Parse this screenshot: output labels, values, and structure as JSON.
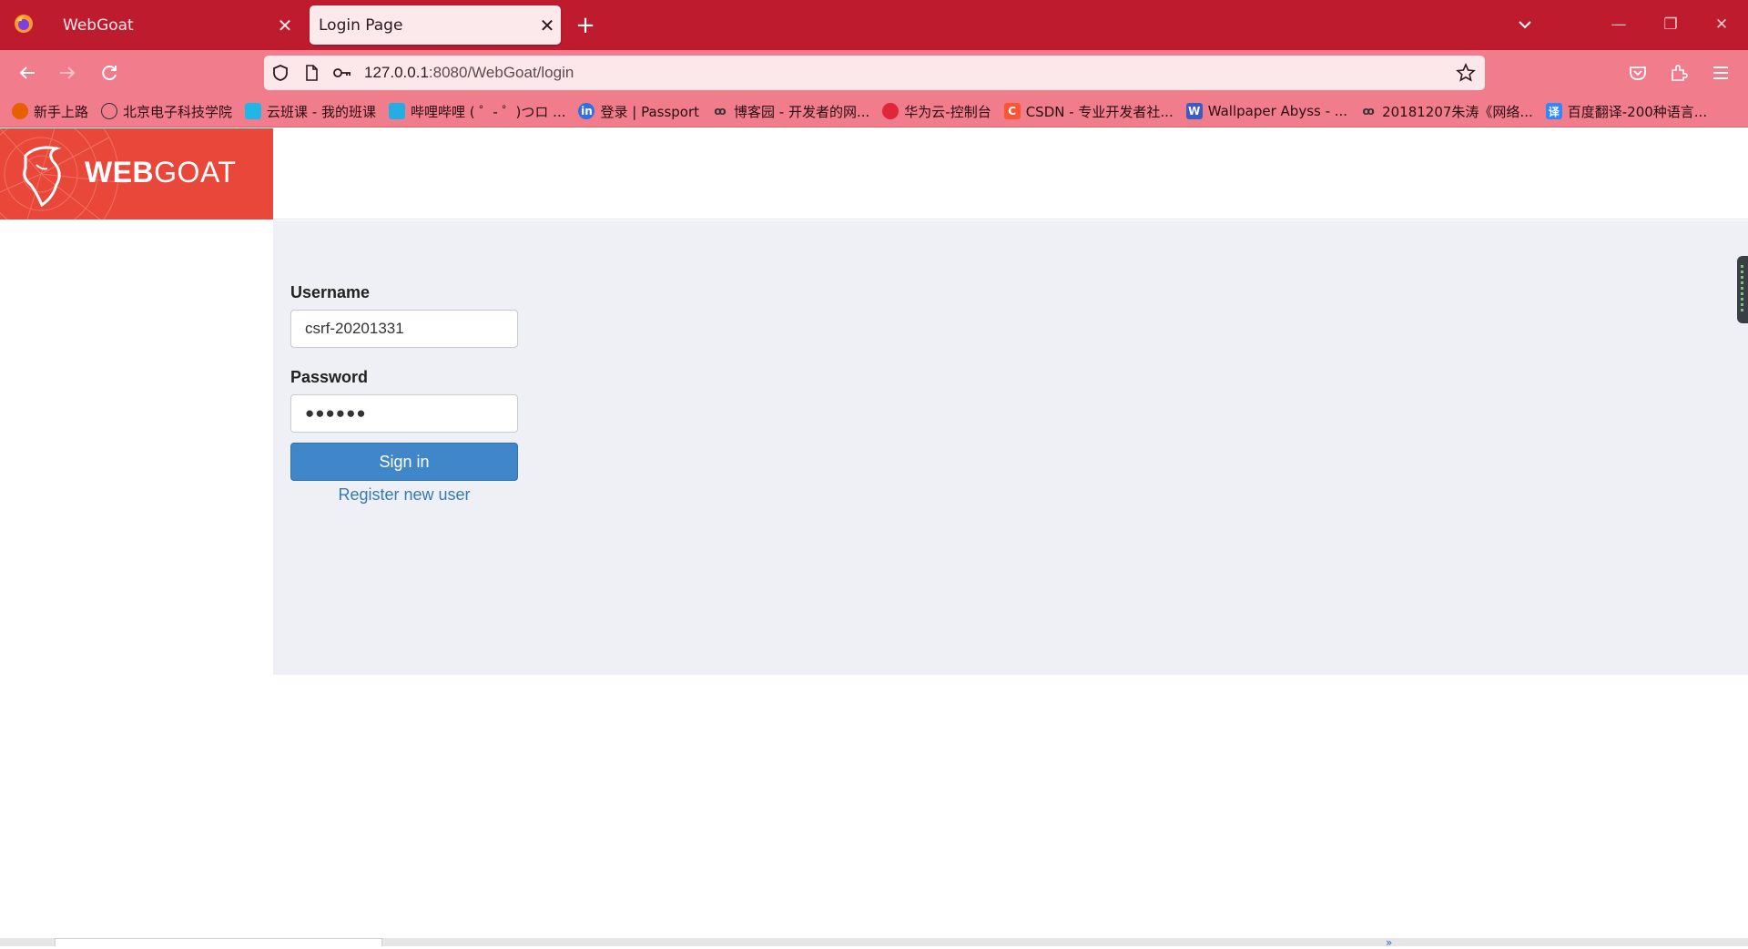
{
  "browser": {
    "tabs": [
      {
        "label": "WebGoat",
        "active": false
      },
      {
        "label": "Login Page",
        "active": true
      }
    ],
    "url": {
      "host": "127.0.0.1",
      "path": ":8080/WebGoat/login"
    },
    "bookmarks": [
      {
        "label": "新手上路",
        "icon": "firefox-icon",
        "color": "#e66000"
      },
      {
        "label": "北京电子科技学院",
        "icon": "globe-icon",
        "color": "#444444"
      },
      {
        "label": "云班课 - 我的班课",
        "icon": "cloud-icon",
        "color": "#1fb6e8"
      },
      {
        "label": "哔哩哔哩 ( ゜- ゜)つロ ...",
        "icon": "tv-icon",
        "color": "#23ade5"
      },
      {
        "label": "登录 | Passport",
        "icon": "passport-icon",
        "color": "#2f6fe0"
      },
      {
        "label": "博客园 - 开发者的网...",
        "icon": "cnblogs-icon",
        "color": "#555555"
      },
      {
        "label": "华为云-控制台",
        "icon": "huawei-icon",
        "color": "#e0263a"
      },
      {
        "label": "CSDN - 专业开发者社...",
        "icon": "csdn-icon",
        "color": "#fc5531"
      },
      {
        "label": "Wallpaper Abyss - ...",
        "icon": "wallpaper-icon",
        "color": "#3a5bc8"
      },
      {
        "label": "20181207朱涛《网络...",
        "icon": "cnblogs-icon",
        "color": "#555555"
      },
      {
        "label": "百度翻译-200种语言...",
        "icon": "translate-icon",
        "color": "#2f88ff"
      }
    ]
  },
  "app": {
    "brand_bold": "WEB",
    "brand_light": "GOAT",
    "brand_color": "#e9473a"
  },
  "login": {
    "username_label": "Username",
    "username_value": "csrf-20201331",
    "password_label": "Password",
    "password_value": "●●●●●●",
    "signin_label": "Sign in",
    "register_label": "Register new user"
  }
}
